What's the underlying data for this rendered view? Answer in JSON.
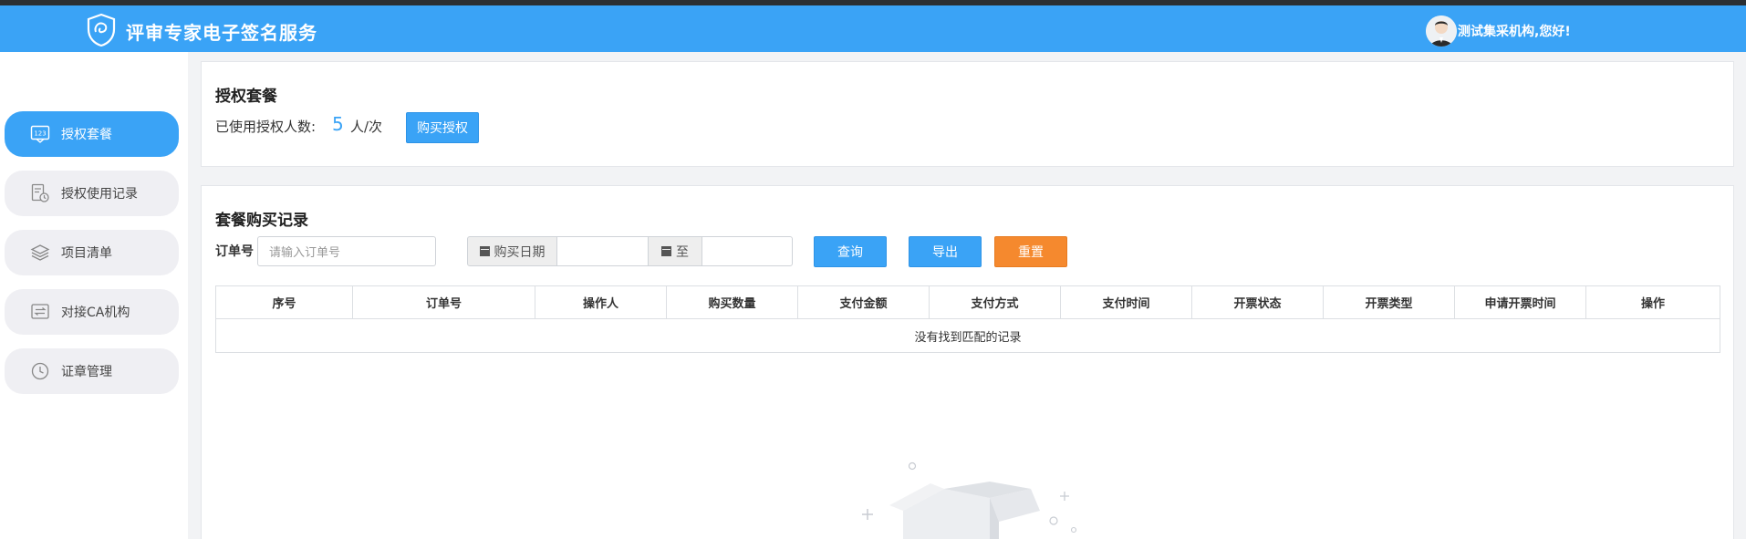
{
  "header": {
    "app_title": "评审专家电子签名服务",
    "welcome_text": "测试集采机构,您好!"
  },
  "colors": {
    "primary": "#3aa3f6",
    "orange": "#f5892e",
    "page_bg": "#f2f3f5"
  },
  "sidebar": {
    "items": [
      {
        "label": "授权套餐",
        "icon": "badge-123-icon",
        "active": true
      },
      {
        "label": "授权使用记录",
        "icon": "document-clock-icon",
        "active": false
      },
      {
        "label": "项目清单",
        "icon": "layers-icon",
        "active": false
      },
      {
        "label": "对接CA机构",
        "icon": "transfer-icon",
        "active": false
      },
      {
        "label": "证章管理",
        "icon": "clock-icon",
        "active": false
      }
    ]
  },
  "auth_panel": {
    "title": "授权套餐",
    "used_label": "已使用授权人数:",
    "used_count": "5",
    "used_unit": "人/次",
    "buy_button": "购买授权"
  },
  "records_panel": {
    "title": "套餐购买记录",
    "filters": {
      "order_label": "订单号",
      "order_placeholder": "请输入订单号",
      "date_label": "购买日期",
      "to_label": "至",
      "date_from_value": "",
      "date_to_value": ""
    },
    "buttons": {
      "query": "查询",
      "export": "导出",
      "reset": "重置"
    },
    "table": {
      "columns": [
        "序号",
        "订单号",
        "操作人",
        "购买数量",
        "支付金额",
        "支付方式",
        "支付时间",
        "开票状态",
        "开票类型",
        "申请开票时间",
        "操作"
      ],
      "empty_text": "没有找到匹配的记录"
    }
  }
}
